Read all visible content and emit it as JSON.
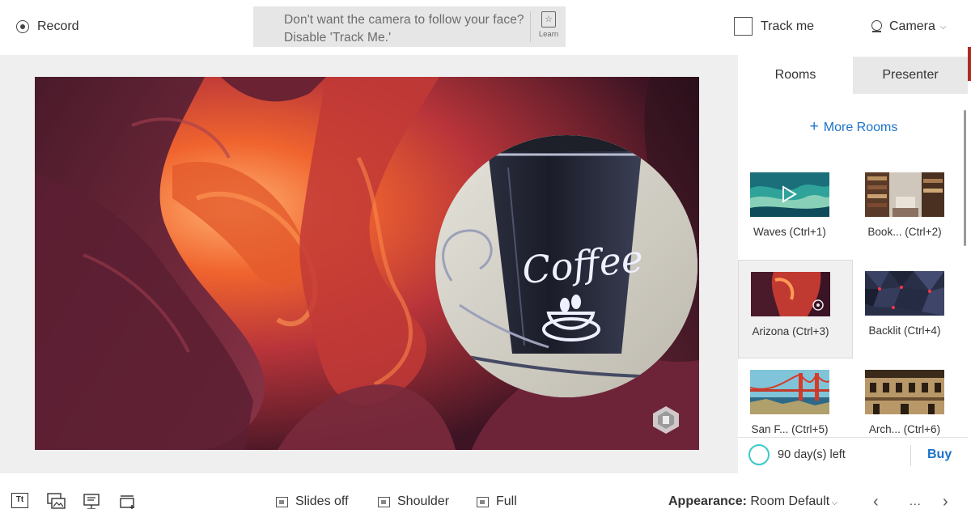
{
  "toolbar": {
    "record_label": "Record",
    "tip_text": "Don't want the camera to follow your face? Disable 'Track Me.'",
    "learn_label": "Learn",
    "trackme_label": "Track me",
    "trackme_checked": false,
    "camera_label": "Camera"
  },
  "panel": {
    "tabs": [
      {
        "label": "Rooms",
        "active": true
      },
      {
        "label": "Presenter",
        "active": false
      }
    ],
    "more_rooms_label": "More Rooms",
    "rooms": [
      {
        "label": "Waves (Ctrl+1)",
        "thumb": "waves",
        "selected": false
      },
      {
        "label": "Book... (Ctrl+2)",
        "thumb": "books",
        "selected": false
      },
      {
        "label": "Arizona (Ctrl+3)",
        "thumb": "arizona",
        "selected": true
      },
      {
        "label": "Backlit (Ctrl+4)",
        "thumb": "backlit",
        "selected": false
      },
      {
        "label": "San F... (Ctrl+5)",
        "thumb": "sanfrancisco",
        "selected": false
      },
      {
        "label": "Arch... (Ctrl+6)",
        "thumb": "architecture",
        "selected": false
      }
    ],
    "trial_text": "90 day(s) left",
    "buy_label": "Buy"
  },
  "camera_feed": {
    "mug_text": "Coffee"
  },
  "bottom": {
    "modes": [
      {
        "label": "Slides off"
      },
      {
        "label": "Shoulder"
      },
      {
        "label": "Full"
      }
    ],
    "appearance_key": "Appearance:",
    "appearance_value": "Room Default",
    "more_label": "..."
  },
  "colors": {
    "accent": "#1a73c8",
    "trial_ring": "#3cc8c8",
    "tip_bg": "#e6e6e6"
  }
}
